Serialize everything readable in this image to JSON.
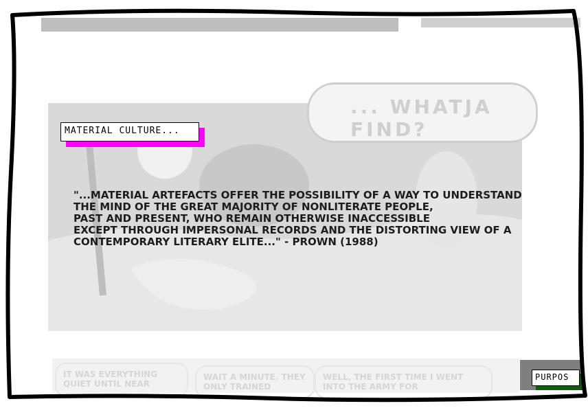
{
  "callout": {
    "label": "MATERIAL CULTURE..."
  },
  "speech": {
    "text": "... WHATJA FIND?"
  },
  "quote": {
    "lines": [
      "\"...MATERIAL ARTEFACTS OFFER THE POSSIBILITY OF A WAY TO UNDERSTAND",
      "THE MIND OF THE GREAT MAJORITY OF NONLITERATE PEOPLE,",
      "PAST AND PRESENT, WHO REMAIN OTHERWISE INACCESSIBLE",
      "EXCEPT THROUGH IMPERSONAL RECORDS AND THE DISTORTING VIEW OF A",
      "CONTEMPORARY LITERARY ELITE...\" - PROWN (1988)"
    ]
  },
  "bottom_strip": {
    "bubble1": "IT WAS EVERYTHING QUIET UNTIL NEAR",
    "bubble2": "WAIT A MINUTE. THEY ONLY TRAINED",
    "bubble3": "WELL, THE FIRST TIME I WENT INTO THE ARMY FOR"
  },
  "next_thumb": {
    "label": "PURPOS"
  },
  "colors": {
    "accent": "#ff00ff",
    "thumb_accent": "#0f5c0f",
    "frame": "#000000"
  }
}
